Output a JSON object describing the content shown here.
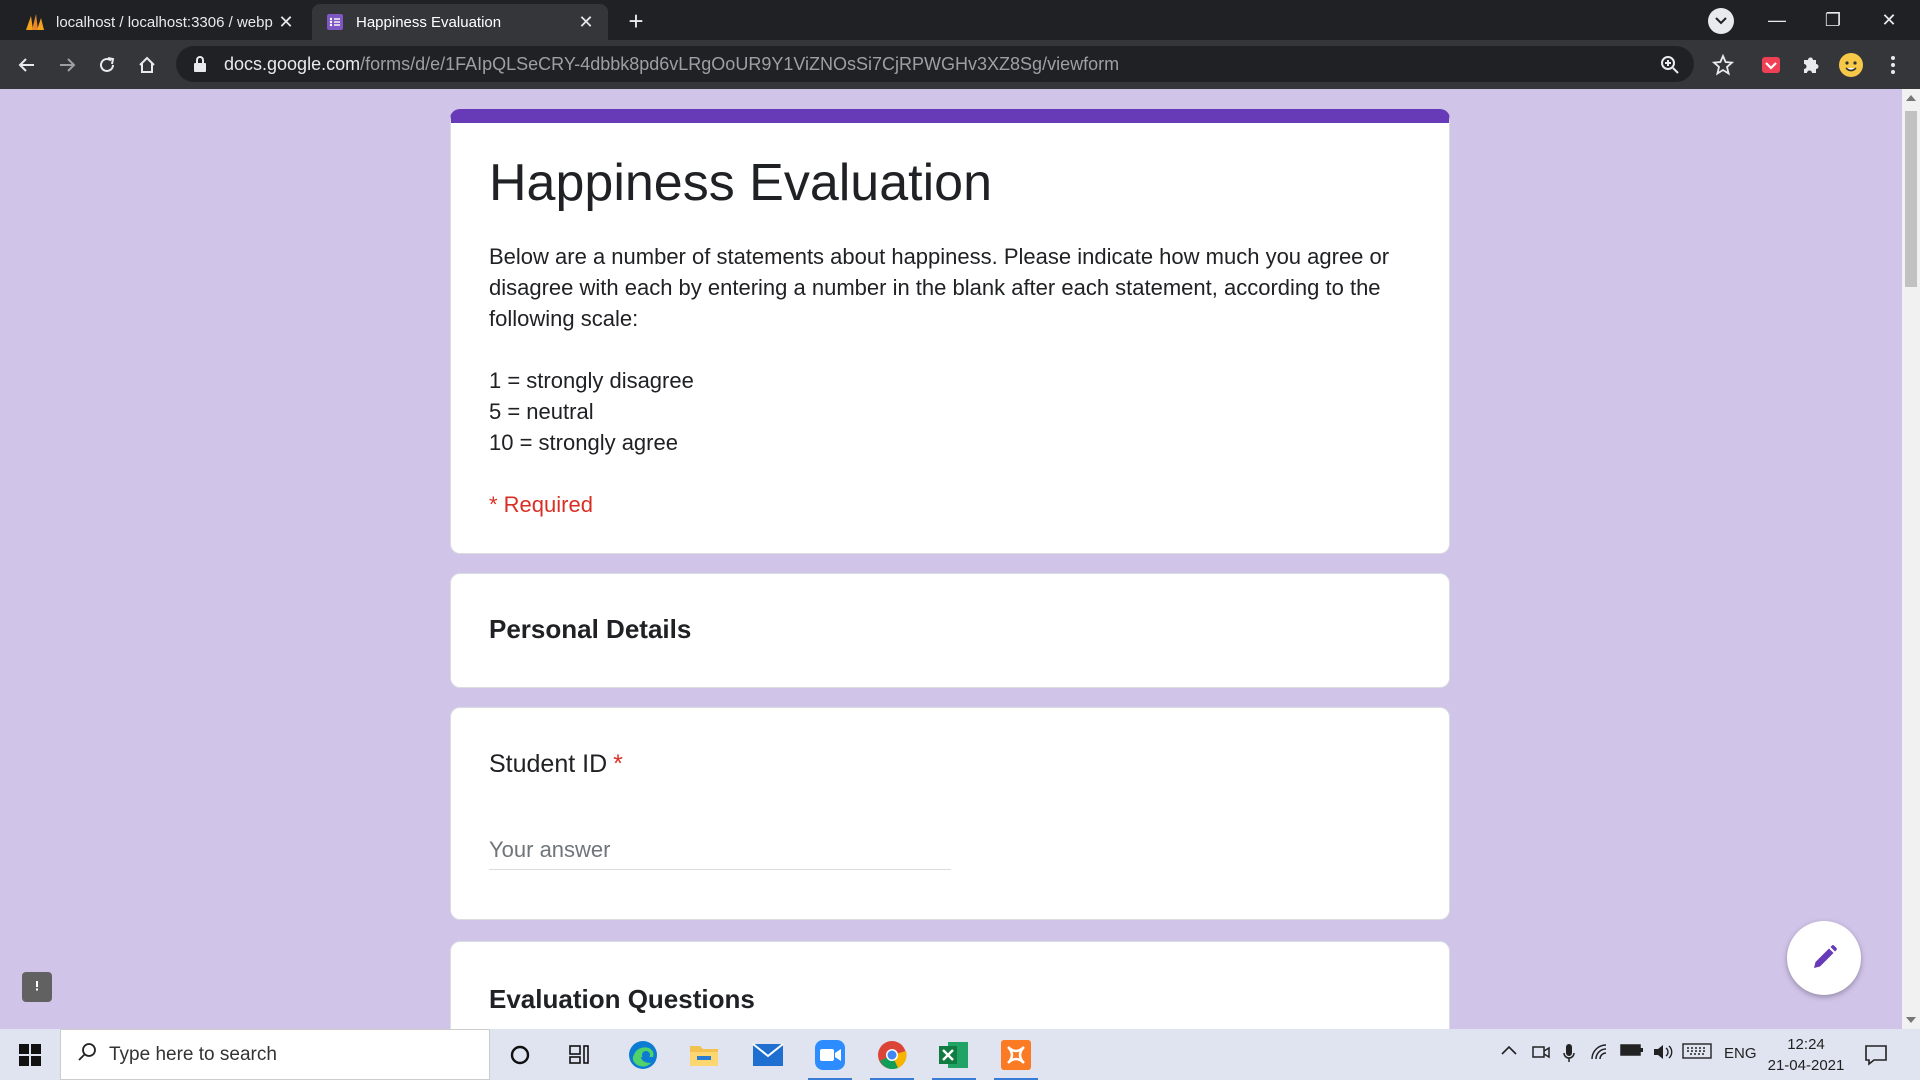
{
  "browser": {
    "tabs": [
      {
        "title": "localhost / localhost:3306 / webp",
        "icon": "phpmyadmin-icon",
        "active": false
      },
      {
        "title": "Happiness Evaluation",
        "icon": "forms-icon",
        "active": true
      }
    ],
    "url_host": "docs.google.com",
    "url_path": "/forms/d/e/1FAIpQLSeCRY-4dbbk8pd6vLRgOoUR9Y1ViZNOsSi7CjRPWGHv3XZ8Sg/viewform"
  },
  "form": {
    "title": "Happiness Evaluation",
    "description": "Below are a number of statements about happiness. Please indicate how much you agree or disagree with each by entering a number in the blank after each statement, according to the following scale:",
    "scale": [
      "1 = strongly disagree",
      "5 = neutral",
      "10 = strongly agree"
    ],
    "required_note": "* Required",
    "sections": {
      "personal": "Personal Details",
      "evaluation": "Evaluation Questions"
    },
    "questions": {
      "student_id": {
        "label": "Student ID",
        "required_mark": "*",
        "placeholder": "Your answer"
      }
    }
  },
  "colors": {
    "theme": "#673ab7",
    "page_bg": "#d1c4e9",
    "required": "#d93025"
  },
  "taskbar": {
    "search_placeholder": "Type here to search",
    "language": "ENG",
    "time": "12:24",
    "date": "21-04-2021"
  }
}
